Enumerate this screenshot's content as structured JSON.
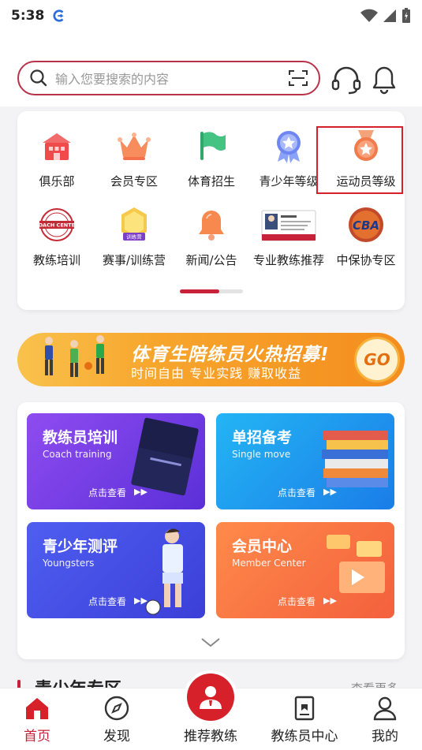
{
  "status": {
    "time": "5:38"
  },
  "search": {
    "placeholder": "输入您要搜索的内容"
  },
  "menu": {
    "row1": [
      "俱乐部",
      "会员专区",
      "体育招生",
      "青少年等级",
      "运动员等级"
    ],
    "row2": [
      "教练培训",
      "赛事/训练营",
      "新闻/公告",
      "专业教练推荐",
      "中保协专区"
    ],
    "icon_texts": {
      "coach_center": "COACH CENTER",
      "training_camp": "训练营",
      "cba": "CBA"
    },
    "highlighted": "运动员等级"
  },
  "banner": {
    "title": "体育生陪练员火热招募!",
    "subtitle": "时间自由   专业实践   赚取收益",
    "go": "GO"
  },
  "features": [
    {
      "title": "教练员培训",
      "sub": "Coach training",
      "view": "点击查看"
    },
    {
      "title": "单招备考",
      "sub": "Single move",
      "view": "点击查看"
    },
    {
      "title": "青少年测评",
      "sub": "Youngsters",
      "view": "点击查看"
    },
    {
      "title": "会员中心",
      "sub": "Member Center",
      "view": "点击查看"
    }
  ],
  "section": {
    "title": "青少年专区",
    "more": "查看更多"
  },
  "tabs": [
    {
      "label": "首页",
      "active": true
    },
    {
      "label": "发现"
    },
    {
      "label": "推荐教练"
    },
    {
      "label": "教练员中心"
    },
    {
      "label": "我的"
    }
  ],
  "colors": {
    "brand": "#c8213a",
    "highlight": "#d6202a"
  }
}
